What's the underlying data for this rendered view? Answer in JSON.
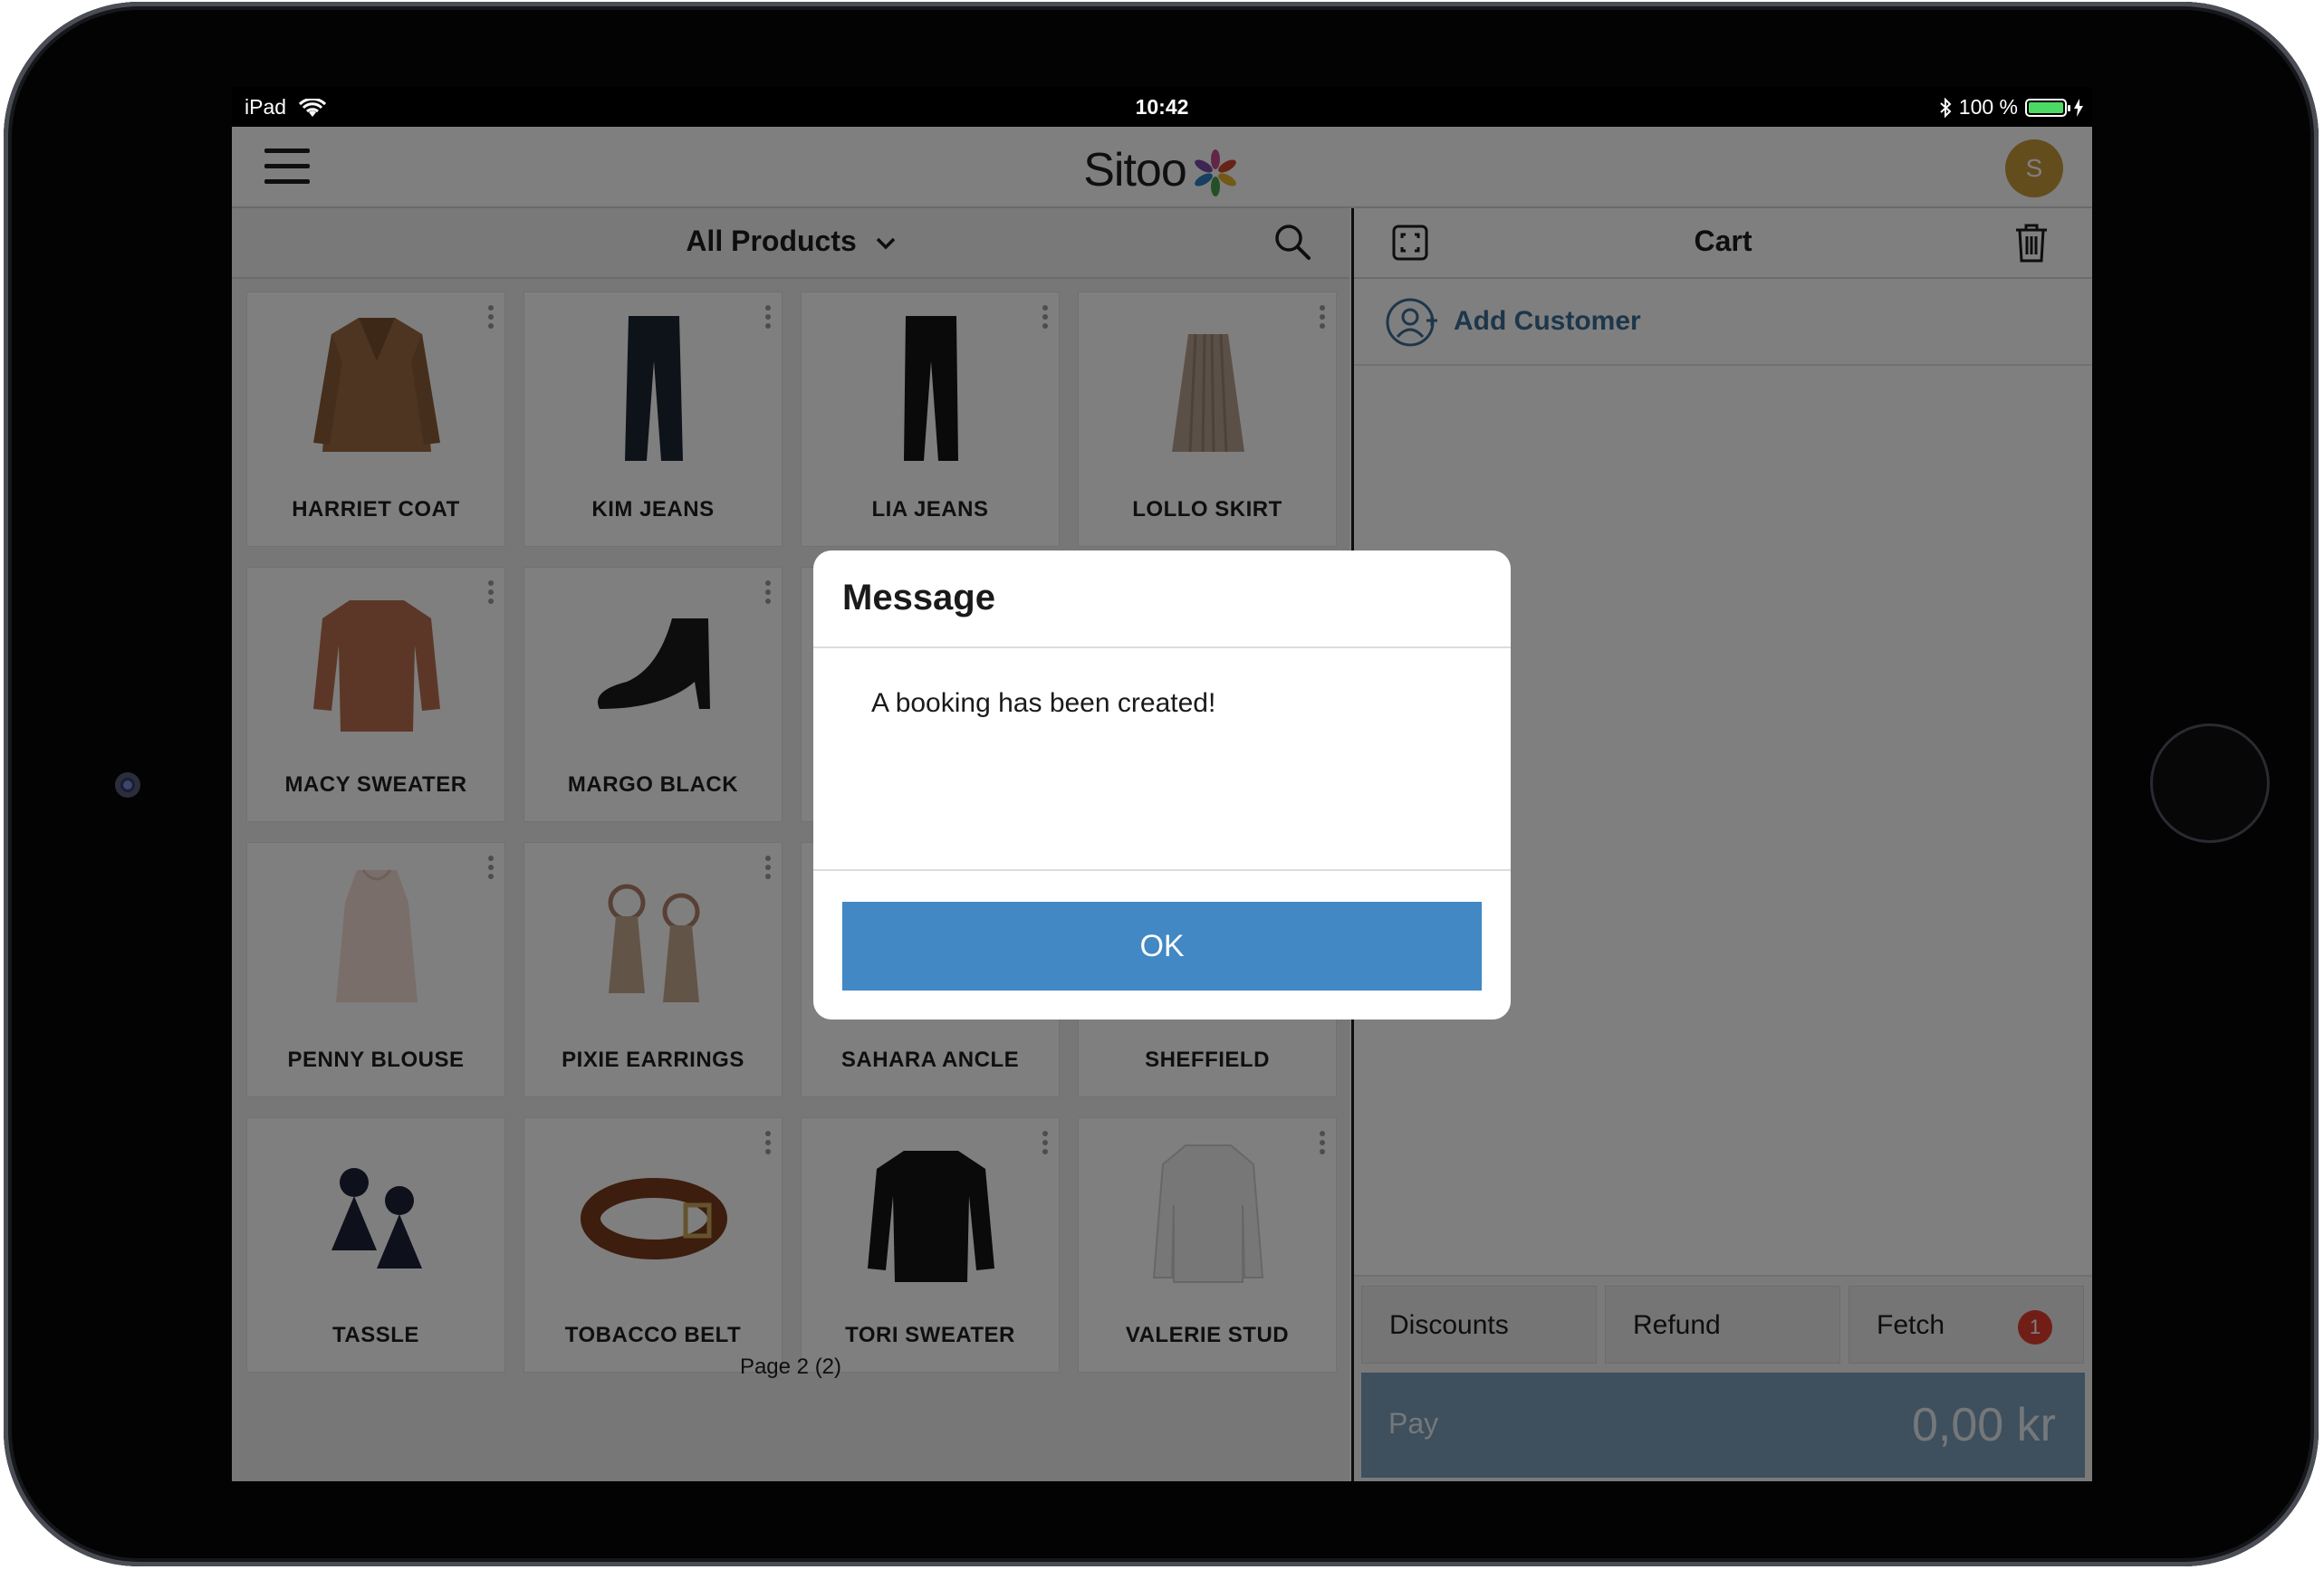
{
  "status_bar": {
    "device": "iPad",
    "time": "10:42",
    "battery": "100 %"
  },
  "header": {
    "logo_text": "Sitoo",
    "avatar_initial": "S"
  },
  "products": {
    "category": "All Products",
    "items": [
      {
        "name": "HARRIET COAT",
        "icon": "coat-icon"
      },
      {
        "name": "KIM JEANS",
        "icon": "jeans-icon"
      },
      {
        "name": "LIA JEANS",
        "icon": "jeans-icon"
      },
      {
        "name": "LOLLO SKIRT",
        "icon": "skirt-icon"
      },
      {
        "name": "MACY SWEATER",
        "icon": "sweater-icon"
      },
      {
        "name": "MARGO BLACK",
        "icon": "boot-icon"
      },
      {
        "name": "",
        "icon": ""
      },
      {
        "name": "",
        "icon": ""
      },
      {
        "name": "PENNY BLOUSE",
        "icon": "blouse-icon"
      },
      {
        "name": "PIXIE EARRINGS",
        "icon": "earrings-icon"
      },
      {
        "name": "SAHARA ANCLE",
        "icon": "boot-icon"
      },
      {
        "name": "SHEFFIELD",
        "icon": "shoe-icon"
      },
      {
        "name": "TASSLE",
        "icon": "tassel-earrings-icon"
      },
      {
        "name": "TOBACCO BELT",
        "icon": "belt-icon"
      },
      {
        "name": "TORI SWEATER",
        "icon": "sweater-icon"
      },
      {
        "name": "VALERIE STUD",
        "icon": "shirt-icon"
      }
    ],
    "pager": "Page 2 (2)"
  },
  "cart": {
    "title": "Cart",
    "add_customer": "Add Customer",
    "actions": {
      "discounts": "Discounts",
      "refund": "Refund",
      "fetch": "Fetch",
      "fetch_badge": "1"
    },
    "pay_label": "Pay",
    "total": "0,00 kr"
  },
  "dialog": {
    "title": "Message",
    "message": "A booking has been created!",
    "ok_label": "OK"
  },
  "colors": {
    "accent": "#4188c4",
    "link": "#3a6d95",
    "badge": "#e33c2f",
    "logo_yellow": "#c89a3a"
  }
}
